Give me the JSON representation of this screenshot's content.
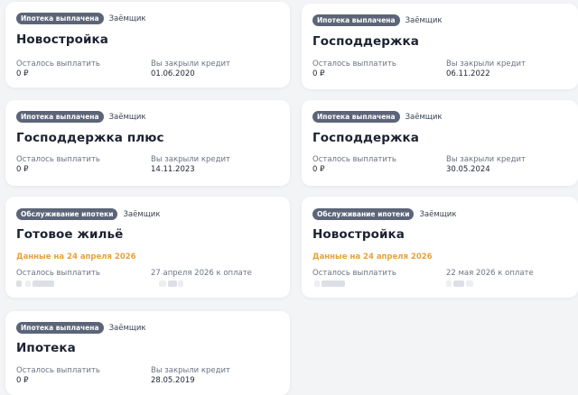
{
  "colors": {
    "page_bg": "#f3f4f6",
    "badge_bg": "#5c6577",
    "accent_orange": "#e4a33a",
    "label_gray": "#6c7383"
  },
  "cards": [
    {
      "badge": "Ипотека выплачена",
      "role": "Заёмщик",
      "title": "Новостройка",
      "left_label": "Осталось выплатить",
      "left_value": "0 ₽",
      "right_label": "Вы закрыли кредит",
      "right_value": "01.06.2020"
    },
    {
      "badge": "Ипотека выплачена",
      "role": "Заёмщик",
      "title": "Господдержка",
      "left_label": "Осталось выплатить",
      "left_value": "0 ₽",
      "right_label": "Вы закрыли кредит",
      "right_value": "06.11.2022"
    },
    {
      "badge": "Ипотека выплачена",
      "role": "Заёмщик",
      "title": "Господдержка плюс",
      "left_label": "Осталось выплатить",
      "left_value": "0 ₽",
      "right_label": "Вы закрыли кредит",
      "right_value": "14.11.2023"
    },
    {
      "badge": "Ипотека выплачена",
      "role": "Заёмщик",
      "title": "Господдержка",
      "left_label": "Осталось выплатить",
      "left_value": "0 ₽",
      "right_label": "Вы закрыли кредит",
      "right_value": "30.05.2024"
    },
    {
      "badge": "Обслуживание ипотеки",
      "role": "Заёмщик",
      "title": "Готовое жильё",
      "date_note": "Данные на 24 апреля 2026",
      "left_label": "Осталось выплатить",
      "right_label": "27 апреля 2026 к оплате"
    },
    {
      "badge": "Обслуживание ипотеки",
      "role": "Заёмщик",
      "title": "Новостройка",
      "date_note": "Данные на 24 апреля 2026",
      "left_label": "Осталось выплатить",
      "right_label": "22 мая 2026 к оплате"
    },
    {
      "badge": "Ипотека выплачена",
      "role": "Заёмщик",
      "title": "Ипотека",
      "left_label": "Осталось выплатить",
      "left_value": "0 ₽",
      "right_label": "Вы закрыли кредит",
      "right_value": "28.05.2019"
    }
  ]
}
